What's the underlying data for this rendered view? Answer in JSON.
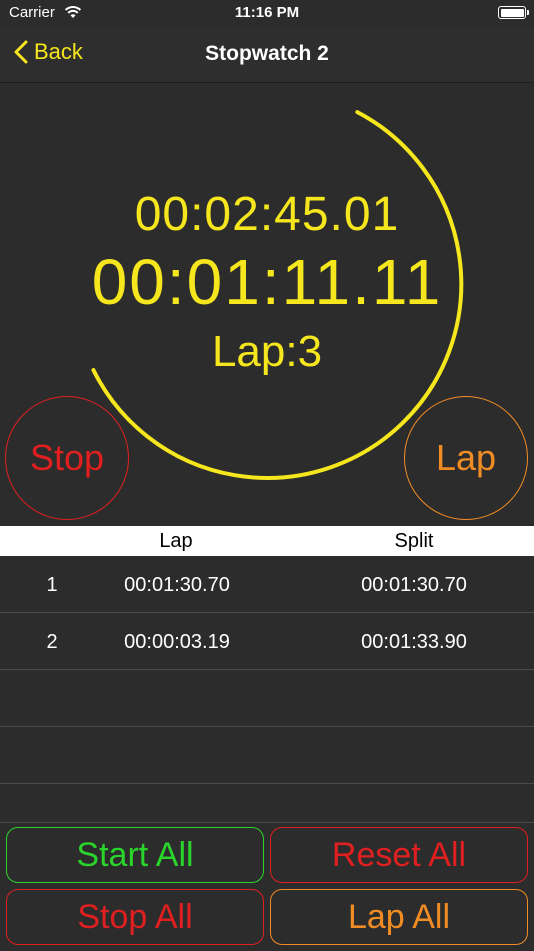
{
  "status_bar": {
    "carrier": "Carrier",
    "time": "11:16 PM"
  },
  "nav": {
    "back_label": "Back",
    "title": "Stopwatch 2"
  },
  "timer": {
    "total": "00:02:45.01",
    "current": "00:01:11.11",
    "lap_count": "Lap:3"
  },
  "controls": {
    "stop": "Stop",
    "lap": "Lap"
  },
  "table": {
    "columns": {
      "lap": "Lap",
      "split": "Split"
    },
    "rows": [
      {
        "num": "1",
        "lap": "00:01:30.70",
        "split": "00:01:30.70"
      },
      {
        "num": "2",
        "lap": "00:00:03.19",
        "split": "00:01:33.90"
      },
      {
        "num": "",
        "lap": "",
        "split": ""
      },
      {
        "num": "",
        "lap": "",
        "split": ""
      },
      {
        "num": "",
        "lap": "",
        "split": ""
      }
    ]
  },
  "bottom_buttons": {
    "start_all": "Start All",
    "reset_all": "Reset All",
    "stop_all": "Stop All",
    "lap_all": "Lap All"
  },
  "colors": {
    "accent": "#f5e61e",
    "stop": "#e02020",
    "lap": "#f08c24",
    "start": "#2ad42a",
    "background": "#2c2c2c"
  }
}
